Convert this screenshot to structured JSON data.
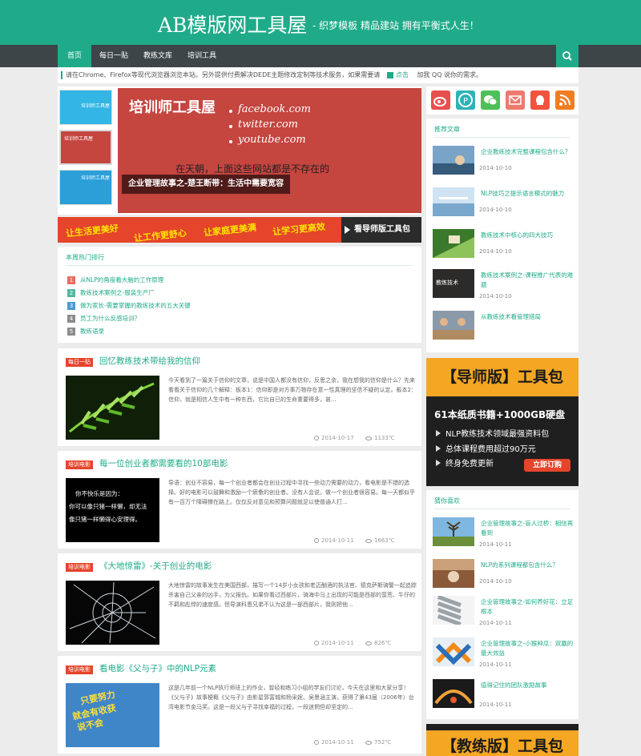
{
  "header": {
    "title": "AB模版网工具屋",
    "slogan": "- 织梦模板  精品建站  拥有平衡式人生！"
  },
  "nav": {
    "items": [
      {
        "label": "首页",
        "active": true
      },
      {
        "label": "每日一贴",
        "active": false
      },
      {
        "label": "教练文库",
        "active": false
      },
      {
        "label": "培训工具",
        "active": false
      }
    ]
  },
  "notice": {
    "text": "请在Chrome、Firefox等现代浏览器浏览本站。另外提供付费解决DEDE主题修改定制等技术服务，如果需要请",
    "link_label": "点击",
    "tail": "加我 QQ 说你的需求。"
  },
  "slider": {
    "title": "培训师工具屋",
    "sites": [
      "facebook.com",
      "twitter.com",
      "youtube.com"
    ],
    "tagline": "在天朝，上面这些网站都是不存在的",
    "caption": "企业管理故事之-楚王断带：生活中需要宽容",
    "thumbs": [
      {
        "label": "培训师工具屋"
      },
      {
        "label": "培训师工具屋"
      },
      {
        "label": "培训师工具屋"
      }
    ]
  },
  "banner": {
    "phrases": [
      "让生活更美好",
      "让工作更舒心",
      "让家庭更美满",
      "让学习更高效"
    ],
    "cta": "看导师版工具包"
  },
  "hot": {
    "title": "本周热门排行",
    "items": [
      {
        "num": "1",
        "text": "从NLP的角度看大脑的工作原理",
        "color": "#e96b63"
      },
      {
        "num": "2",
        "text": "教练技术案例之-服装生产厂",
        "color": "#52b9a0"
      },
      {
        "num": "3",
        "text": "做为家长-需要掌握的教练技术的五大关键",
        "color": "#4a9ad4"
      },
      {
        "num": "4",
        "text": "员工为什么反感培训？",
        "color": "#8b8b8b"
      },
      {
        "num": "5",
        "text": "教练语录",
        "color": "#8b8b8b"
      }
    ]
  },
  "posts": [
    {
      "tag": "每日一贴",
      "title": "回忆教练技术带给我的信仰",
      "excerpt": "今天看到了一篇关于信仰的文章，说是中国人都没有信仰，反思之余，我在想我的信仰是什么？先来看看关于信仰的几个解释：板本1：信仰即是对方事万物存在意一性真理的坚信不疑的认定。板本2：信仰，就是相信人生中有一种东西，它比自已的生命重要得多，甚...",
      "date": "2014-10-17",
      "views": "1133℃"
    },
    {
      "tag": "培训电影",
      "title": "每一位创业者都需要看的10部电影",
      "excerpt": "导语：创业不容易，每一个创业者都会在创业过程中寻找一些动力需要的动力，看电影是不错的选择。好的电影可以鼓舞和激励一个疲惫的创业者。没有人会说，做一个创业者很容易。每一天都似乎有一百万个障碍撑在路上。仅仅反对意见和预算问题就足以使普通人打...",
      "date": "2014-10-11",
      "views": "1663℃",
      "img_text": [
        "你不快乐是因为：",
        "你可以像只猪一样懒，却无法",
        "像只猪一样懒得心安理得。"
      ]
    },
    {
      "tag": "培训电影",
      "title": "《大地惊雷》-关于创业的电影",
      "excerpt": "大地惊雷的故事发生在美国西部，描写一个14岁小女孩和老迈酗酒的执法官、德克萨斯骑警一起追踪杀害自己父亲的凶手，为父报仇。如果你看过西部片，骑海中马上出现的可能是西部的蛮荒、牛仔的不羁和彪悍的速度感。但导演科恩兄弟不认为这是一部西部片，我则把他...",
      "date": "2014-10-11",
      "views": "826℃"
    },
    {
      "tag": "培训电影",
      "title": "看电影《父与子》中的NLP元素",
      "excerpt": "这是几年前一个NLP执行师班上的作业，曾经和练习小组的学友们讨论，今天在这里和大家分享！《父与子》故事梗概《父与子》由影星郭富城和杨采妮、吴景涵主演，获得了第43届（2006年）台湾电影节金马奖。这是一段父与子寻找幸福的过程，一段迷惘但却坚定的...",
      "date": "2014-10-11",
      "views": "752℃",
      "img_text": [
        "只要努力",
        "就会有收获",
        "说不会"
      ]
    }
  ],
  "sidebar": {
    "recommend": {
      "title": "推荐文章",
      "items": [
        {
          "title": "企业教练技术完整课程包含什么？",
          "date": "2014-10-10"
        },
        {
          "title": "NLP技巧之提示语言模式的魅力",
          "date": "2014-10-10"
        },
        {
          "title": "教练技术中核心的四大技巧",
          "date": "2014-10-10"
        },
        {
          "title": "教练技术案例之-课程推广代表的难题",
          "date": "2014-10-10",
          "img_text": "教练技术"
        },
        {
          "title": "从教练技术看管理措局",
          "date": "2014-10-10"
        }
      ]
    },
    "ad1": {
      "title": "【导师版】工具包",
      "subtitle": "61本纸质书籍+1000GB硬盘",
      "bullets": [
        "NLP教练技术领域最强资料包",
        "总体课程费用超过90万元",
        "终身免费更新"
      ],
      "button": "立即订购"
    },
    "guess": {
      "title": "猜你喜欢",
      "items": [
        {
          "title": "企业管理故事之-盲人过桥：相信再看到",
          "date": "2014-10-11"
        },
        {
          "title": "NLP的系列课程都包含什么？",
          "date": "2014-10-10"
        },
        {
          "title": "企业管理故事之-如何养好花：立足根本",
          "date": "2014-10-11"
        },
        {
          "title": "企业管理故事之-小猴种瓜：双赢的最大效益",
          "date": "2014-10-11"
        },
        {
          "title": "值得记住的团队激励故事",
          "date": "2014-10-11"
        }
      ]
    },
    "ad2": {
      "title": "【教练版】工具包"
    }
  },
  "colors": {
    "brand": "#1fab89",
    "nav_bg": "#3d4548",
    "tag": "#e4452b",
    "ad_accent": "#f5a623"
  }
}
